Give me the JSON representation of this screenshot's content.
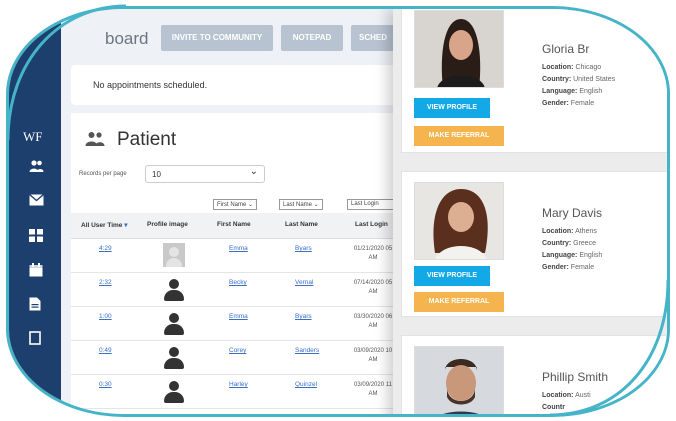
{
  "sidebar": {
    "brand": "WF",
    "icons": [
      "users-icon",
      "mail-icon",
      "grid-icon",
      "calendar-icon",
      "document-icon",
      "export-icon"
    ]
  },
  "header": {
    "title": "board",
    "buttons": [
      "INVITE TO COMMUNITY",
      "NOTEPAD",
      "SCHED"
    ]
  },
  "appointments": {
    "message": "No appointments scheduled."
  },
  "patient": {
    "title": "Patient",
    "records_label": "Records per page",
    "records_value": "10",
    "filters": [
      "First Name",
      "Last Name",
      "Last Login"
    ],
    "columns": [
      "All User Time",
      "Profile image",
      "First Name",
      "Last Name",
      "Last Login"
    ],
    "rows": [
      {
        "time": "4:29",
        "first": "Emma",
        "last": "Byars",
        "login_date": "01/21/2020 05",
        "login_ampm": "AM",
        "avatar": "photo"
      },
      {
        "time": "2:32",
        "first": "Becky",
        "last": "Vernal",
        "login_date": "07/14/2020 05",
        "login_ampm": "AM",
        "avatar": "generic"
      },
      {
        "time": "1:00",
        "first": "Emma",
        "last": "Byars",
        "login_date": "03/30/2020 06",
        "login_ampm": "AM",
        "avatar": "generic"
      },
      {
        "time": "0:49",
        "first": "Corey",
        "last": "Sanders",
        "login_date": "03/09/2020 10",
        "login_ampm": "AM",
        "avatar": "generic"
      },
      {
        "time": "0:30",
        "first": "Harley",
        "last": "Quinzel",
        "login_date": "03/09/2020 11",
        "login_ampm": "AM",
        "avatar": "generic"
      }
    ]
  },
  "cards": [
    {
      "name": "Gloria Br",
      "info": [
        {
          "label": "Location:",
          "value": "Chicago"
        },
        {
          "label": "Country:",
          "value": "United States"
        },
        {
          "label": "Language:",
          "value": "English"
        },
        {
          "label": "Gender:",
          "value": "Female"
        }
      ],
      "view_label": "VIEW PROFILE",
      "referral_label": "MAKE REFERRAL"
    },
    {
      "name": "Mary Davis",
      "info": [
        {
          "label": "Location:",
          "value": "Athens"
        },
        {
          "label": "Country:",
          "value": "Greece"
        },
        {
          "label": "Language:",
          "value": "English"
        },
        {
          "label": "Gender:",
          "value": "Female"
        }
      ],
      "view_label": "VIEW PROFILE",
      "referral_label": "MAKE REFERRAL"
    },
    {
      "name": "Phillip Smith",
      "info": [
        {
          "label": "Location:",
          "value": "Austi"
        },
        {
          "label": "Countr",
          "value": ""
        }
      ]
    }
  ],
  "colors": {
    "sidebar": "#1c3f6e",
    "accent_blue": "#13a9e6",
    "accent_orange": "#f6b44f",
    "rim": "#45b3c8",
    "link": "#3a6fc4"
  }
}
